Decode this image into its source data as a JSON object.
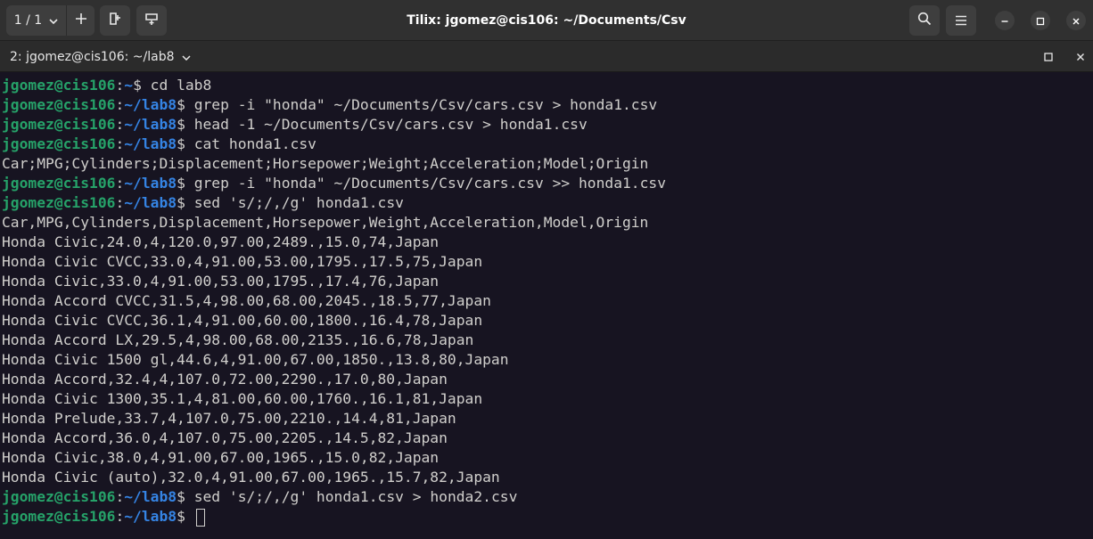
{
  "header": {
    "session_label": "1 / 1",
    "window_title": "Tilix: jgomez@cis106: ~/Documents/Csv",
    "icons": {
      "session": "chevron-down-icon",
      "add": "plus-icon",
      "split_right": "split-right-icon",
      "split_down": "split-down-icon",
      "search": "search-icon",
      "menu": "hamburger-menu-icon",
      "minimize": "minimize-icon",
      "maximize": "maximize-icon",
      "close": "close-icon"
    }
  },
  "terminal_tab": {
    "title": "2: jgomez@cis106: ~/lab8"
  },
  "colors": {
    "prompt_user": "#26a269",
    "prompt_path": "#3584e4",
    "text": "#d0cfcc",
    "background": "#171421"
  },
  "terminal": {
    "lines": [
      {
        "user": "jgomez@cis106",
        "path": "~",
        "cmd": "cd lab8"
      },
      {
        "user": "jgomez@cis106",
        "path": "~/lab8",
        "cmd": "grep -i \"honda\" ~/Documents/Csv/cars.csv > honda1.csv"
      },
      {
        "user": "jgomez@cis106",
        "path": "~/lab8",
        "cmd": "head -1 ~/Documents/Csv/cars.csv > honda1.csv"
      },
      {
        "user": "jgomez@cis106",
        "path": "~/lab8",
        "cmd": "cat honda1.csv"
      },
      {
        "text": "Car;MPG;Cylinders;Displacement;Horsepower;Weight;Acceleration;Model;Origin"
      },
      {
        "user": "jgomez@cis106",
        "path": "~/lab8",
        "cmd": "grep -i \"honda\" ~/Documents/Csv/cars.csv >> honda1.csv"
      },
      {
        "user": "jgomez@cis106",
        "path": "~/lab8",
        "cmd": "sed 's/;/,/g' honda1.csv"
      },
      {
        "text": "Car,MPG,Cylinders,Displacement,Horsepower,Weight,Acceleration,Model,Origin"
      },
      {
        "text": "Honda Civic,24.0,4,120.0,97.00,2489.,15.0,74,Japan"
      },
      {
        "text": "Honda Civic CVCC,33.0,4,91.00,53.00,1795.,17.5,75,Japan"
      },
      {
        "text": "Honda Civic,33.0,4,91.00,53.00,1795.,17.4,76,Japan"
      },
      {
        "text": "Honda Accord CVCC,31.5,4,98.00,68.00,2045.,18.5,77,Japan"
      },
      {
        "text": "Honda Civic CVCC,36.1,4,91.00,60.00,1800.,16.4,78,Japan"
      },
      {
        "text": "Honda Accord LX,29.5,4,98.00,68.00,2135.,16.6,78,Japan"
      },
      {
        "text": "Honda Civic 1500 gl,44.6,4,91.00,67.00,1850.,13.8,80,Japan"
      },
      {
        "text": "Honda Accord,32.4,4,107.0,72.00,2290.,17.0,80,Japan"
      },
      {
        "text": "Honda Civic 1300,35.1,4,81.00,60.00,1760.,16.1,81,Japan"
      },
      {
        "text": "Honda Prelude,33.7,4,107.0,75.00,2210.,14.4,81,Japan"
      },
      {
        "text": "Honda Accord,36.0,4,107.0,75.00,2205.,14.5,82,Japan"
      },
      {
        "text": "Honda Civic,38.0,4,91.00,67.00,1965.,15.0,82,Japan"
      },
      {
        "text": "Honda Civic (auto),32.0,4,91.00,67.00,1965.,15.7,82,Japan"
      },
      {
        "user": "jgomez@cis106",
        "path": "~/lab8",
        "cmd": "sed 's/;/,/g' honda1.csv > honda2.csv"
      },
      {
        "user": "jgomez@cis106",
        "path": "~/lab8",
        "cmd": "",
        "cursor": true
      }
    ]
  }
}
